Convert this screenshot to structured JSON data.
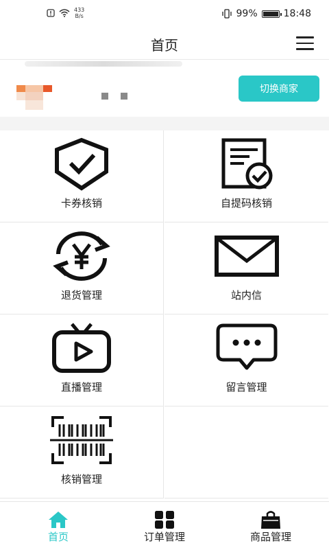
{
  "status_bar": {
    "net_speed_value": "433",
    "net_speed_unit": "B/s",
    "battery": "99%",
    "time": "18:48"
  },
  "header": {
    "title": "首页"
  },
  "merchant": {
    "switch_label": "切换商家"
  },
  "grid": [
    {
      "label": "卡券核销",
      "icon": "shield-check-icon"
    },
    {
      "label": "自提码核销",
      "icon": "document-check-icon"
    },
    {
      "label": "退货管理",
      "icon": "yuan-refund-icon"
    },
    {
      "label": "站内信",
      "icon": "envelope-icon"
    },
    {
      "label": "直播管理",
      "icon": "tv-play-icon"
    },
    {
      "label": "留言管理",
      "icon": "chat-bubble-icon"
    },
    {
      "label": "核销管理",
      "icon": "barcode-scan-icon"
    }
  ],
  "tabbar": {
    "items": [
      {
        "label": "首页",
        "icon": "home-icon",
        "active": true
      },
      {
        "label": "订单管理",
        "icon": "grid-icon",
        "active": false
      },
      {
        "label": "商品管理",
        "icon": "shopping-bag-icon",
        "active": false
      }
    ],
    "accent": "#2ac7c7"
  },
  "colors": {
    "accent": "#2ac7c7",
    "text": "#222222"
  }
}
